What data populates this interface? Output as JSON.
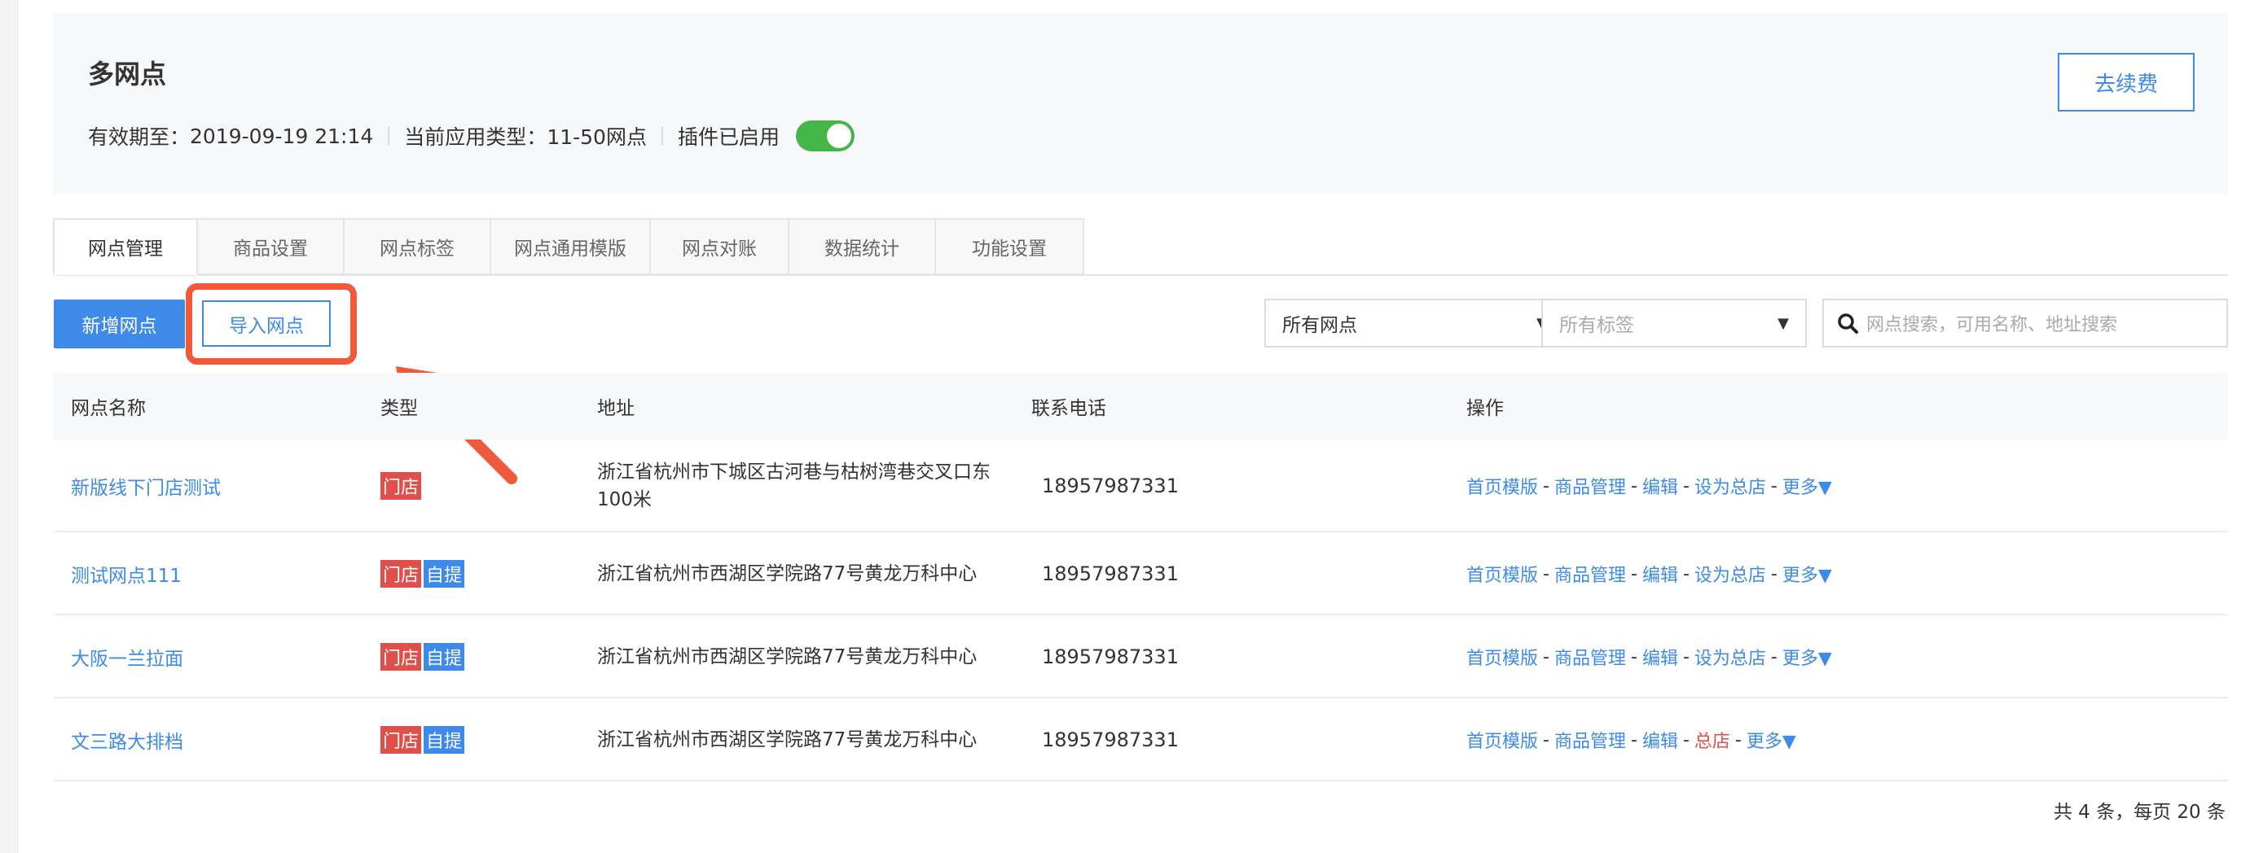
{
  "header": {
    "title": "多网点",
    "valid_until_label": "有效期至：",
    "valid_until_value": "2019-09-19 21:14",
    "app_type_label": "当前应用类型：",
    "app_type_value": "11-50网点",
    "plugin_status": "插件已启用",
    "plugin_enabled": true,
    "renew_button": "去续费"
  },
  "tabs": [
    {
      "label": "网点管理",
      "active": true
    },
    {
      "label": "商品设置",
      "active": false
    },
    {
      "label": "网点标签",
      "active": false
    },
    {
      "label": "网点通用模版",
      "active": false
    },
    {
      "label": "网点对账",
      "active": false
    },
    {
      "label": "数据统计",
      "active": false
    },
    {
      "label": "功能设置",
      "active": false
    }
  ],
  "toolbar": {
    "add_button": "新增网点",
    "import_button": "导入网点",
    "filter_outlets": "所有网点",
    "filter_tags_placeholder": "所有标签",
    "search_placeholder": "网点搜索，可用名称、地址搜索"
  },
  "table": {
    "columns": [
      "网点名称",
      "类型",
      "地址",
      "联系电话",
      "操作"
    ],
    "rows": [
      {
        "name": "新版线下门店测试",
        "types": [
          "门店"
        ],
        "address_line1": "浙江省杭州市下城区古河巷与枯树湾巷交叉口东",
        "address_line2": "100米",
        "phone": "18957987331",
        "ops": [
          "首页模版",
          "商品管理",
          "编辑",
          "设为总店",
          "更多▼"
        ],
        "is_hq": false
      },
      {
        "name": "测试网点111",
        "types": [
          "门店",
          "自提"
        ],
        "address_line1": "浙江省杭州市西湖区学院路77号黄龙万科中心",
        "address_line2": "",
        "phone": "18957987331",
        "ops": [
          "首页模版",
          "商品管理",
          "编辑",
          "设为总店",
          "更多▼"
        ],
        "is_hq": false
      },
      {
        "name": "大阪一兰拉面",
        "types": [
          "门店",
          "自提"
        ],
        "address_line1": "浙江省杭州市西湖区学院路77号黄龙万科中心",
        "address_line2": "",
        "phone": "18957987331",
        "ops": [
          "首页模版",
          "商品管理",
          "编辑",
          "设为总店",
          "更多▼"
        ],
        "is_hq": false
      },
      {
        "name": "文三路大排档",
        "types": [
          "门店",
          "自提"
        ],
        "address_line1": "浙江省杭州市西湖区学院路77号黄龙万科中心",
        "address_line2": "",
        "phone": "18957987331",
        "ops": [
          "首页模版",
          "商品管理",
          "编辑",
          "总店",
          "更多▼"
        ],
        "is_hq": true
      }
    ]
  },
  "pager": {
    "summary": "共 4 条，每页 20 条"
  },
  "colors": {
    "accent": "#3d8ae8",
    "danger": "#e0504a",
    "toggle_on": "#44b549",
    "highlight": "#f0593a"
  }
}
